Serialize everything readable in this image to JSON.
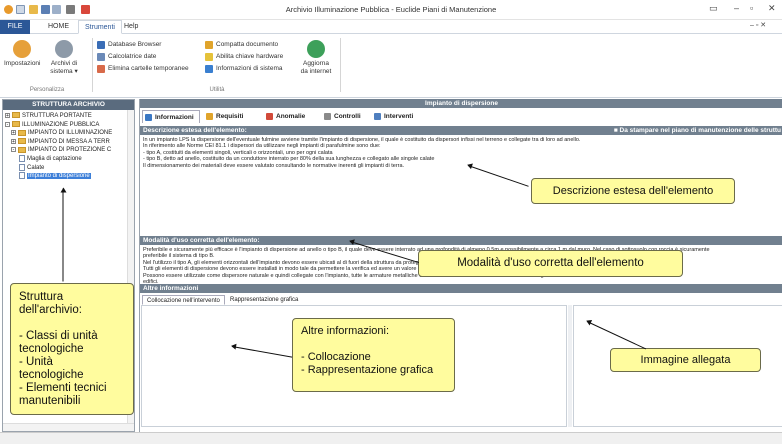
{
  "window": {
    "title": "Archivio Illuminazione Pubblica - Euclide Piani di Manutenzione"
  },
  "tabs": [
    {
      "label": "FILE"
    },
    {
      "label": "HOME"
    },
    {
      "label": "Strumenti"
    },
    {
      "label": "Help"
    }
  ],
  "ribbon": {
    "impostazioni": "Impostazioni",
    "archivi_1": "Archivi di",
    "archivi_2": "sistema ▾",
    "database_browser": "Database Browser",
    "calcolatrice": "Calcolatrice date",
    "elimina": "Elimina cartelle temporanee",
    "compatta": "Compatta documento",
    "abilita": "Abilita chiave hardware",
    "informazioni": "Informazioni di sistema",
    "aggiorna_1": "Aggiorna",
    "aggiorna_2": "da internet",
    "group_personalizza": "Personalizza",
    "group_utilita": "Utilità"
  },
  "left_panel": {
    "title": "STRUTTURA ARCHIVIO",
    "tree": [
      {
        "label": "STRUTTURA PORTANTE",
        "type": "folder",
        "expander": "+"
      },
      {
        "label": "ILLUMINAZIONE PUBBLICA",
        "type": "folder",
        "expander": "-"
      },
      {
        "label": "IMPIANTO DI ILLUMINAZIONE",
        "type": "folder",
        "expander": "+"
      },
      {
        "label": "IMPIANTO DI MESSA A TERR",
        "type": "folder",
        "expander": "+"
      },
      {
        "label": "IMPIANTO DI PROTEZIONE C",
        "type": "folder",
        "expander": "-"
      },
      {
        "label": "Maglia di captazione",
        "type": "doc",
        "expander": ""
      },
      {
        "label": "Calate",
        "type": "doc",
        "expander": ""
      },
      {
        "label": "Impianto di dispersione",
        "type": "doc",
        "expander": "",
        "selected": true
      }
    ]
  },
  "main": {
    "header": "Impianto di dispersione",
    "doc_tabs": [
      {
        "label": "Informazioni",
        "icon_color": "#3b78c4"
      },
      {
        "label": "Requisiti",
        "icon_color": "#e0a42b"
      },
      {
        "label": "Anomalie",
        "icon_color": "#d24a3a"
      },
      {
        "label": "Controlli",
        "icon_color": "#8a8a8a"
      },
      {
        "label": "Interventi",
        "icon_color": "#4f7fbf"
      }
    ],
    "desc_header": "Descrizione estesa dell'elemento:",
    "desc_right": "■ Da stampare nel piano di manutenzione delle struttu",
    "desc_lines": [
      "In un impianto LPS la dispersione dell'eventuale fulmine avviene tramite l'impianto di dispersione, il quale è costituito da dispersori infissi nel terreno e collegate tra di loro ad anello.",
      "In riferimento alle Norme CEI 81.1 i dispersori da utilizzare negli impianti di parafulmine sono due:",
      "- tipo A, costituiti da elementi singoli, verticali o orizzontali, uno per ogni calata",
      "- tipo B, detto ad anello, costituito da un conduttore interrato per 80% della sua lunghezza e collegato alle singole calate",
      "Il dimensionamento dei materiali deve essere valutato consultando le normative inerenti gli impianti di terra."
    ],
    "uso_header": "Modalità d'uso corretta dell'elemento:",
    "uso_lines": [
      "Preferibile e sicuramente più efficace è l'impianto di dispersione ad anello o tipo B, il quale deve essere interrato ad una profondità di almeno 0.5m e possibilmente a circa 1 m dal muro. Nel caso di sottosuolo con roccia è sicuramente",
      "preferibile il sistema di tipo B.",
      "  Nel l'utilizzo il tipo A, gli elementi orizzontali dell'impianto devono essere ubicati al di fuori della struttura da proteggere ad una profondità di circa 0.5m e distribuiti il più uniformemente possibile.",
      "Tutti gli elementi di dispersione devono essere installati in modo tale da permettere la verifica ed avere un valore di resistenza di terra più basso possibile.",
      "Possono essere utilizzate come dispersore naturale e quindi collegate con l'impianto, tutte le armature metalliche contenute nelle fondazioni                                                                                                   ione in calcestruzzo degli",
      "edifici."
    ],
    "altre_header": "Altre informazioni",
    "subtabs": [
      {
        "label": "Collocazione nell'intervento"
      },
      {
        "label": "Rappresentazione grafica"
      }
    ]
  },
  "callouts": {
    "struttura": [
      "Struttura",
      "dell'archivio:",
      "",
      "- Classi di unità",
      "tecnologiche",
      "- Unità",
      "tecnologiche",
      "- Elementi tecnici",
      "manutenibili"
    ],
    "descrizione": "Descrizione estesa dell'elemento",
    "modalita": "Modalità d'uso corretta dell'elemento",
    "altre": [
      "Altre informazioni:",
      "",
      "- Collocazione",
      "- Rappresentazione grafica"
    ],
    "immagine": "Immagine allegata"
  },
  "colors": {
    "file_tab": "#2b5797",
    "callout_fill": "#fffc9e",
    "header_grey": "#71808f",
    "selection": "#3d7fd8"
  }
}
